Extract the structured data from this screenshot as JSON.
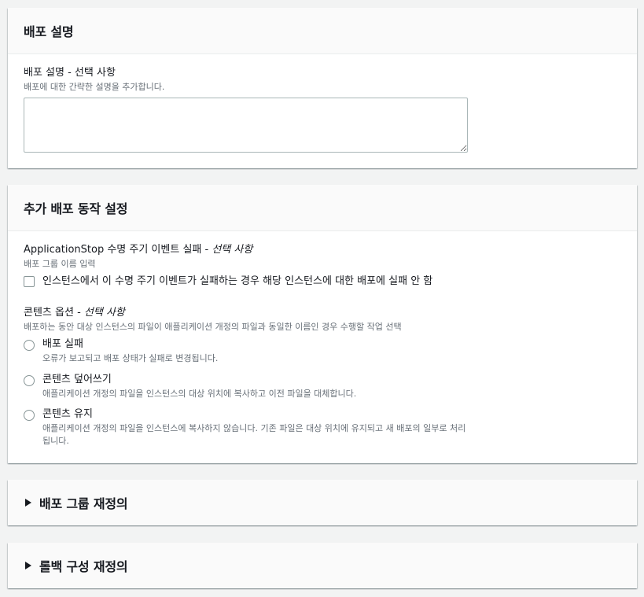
{
  "deployment_description": {
    "panel_title": "배포 설명",
    "field_label": "배포 설명 - 선택 사항",
    "field_desc": "배포에 대한 간략한 설명을 추가합니다.",
    "textarea_value": ""
  },
  "additional_settings": {
    "panel_title": "추가 배포 동작 설정",
    "app_stop": {
      "label_main": "ApplicationStop 수명 주기 이벤트 실패 - ",
      "label_optional": "선택 사항",
      "desc": "배포 그룹 이름 입력",
      "checkbox_label": "인스턴스에서 이 수명 주기 이벤트가 실패하는 경우 해당 인스턴스에 대한 배포에 실패 안 함",
      "checked": false
    },
    "content_options": {
      "label_main": "콘텐츠 옵션 - ",
      "label_optional": "선택 사항",
      "desc": "배포하는 동안 대상 인스턴스의 파일이 애플리케이션 개정의 파일과 동일한 이름인 경우 수행할 작업 선택",
      "options": [
        {
          "label": "배포 실패",
          "desc": "오류가 보고되고 배포 상태가 실패로 변경됩니다."
        },
        {
          "label": "콘텐츠 덮어쓰기",
          "desc": "애플리케이션 개정의 파일을 인스턴스의 대상 위치에 복사하고 이전 파일을 대체합니다."
        },
        {
          "label": "콘텐츠 유지",
          "desc": "애플리케이션 개정의 파일을 인스턴스에 복사하지 않습니다. 기존 파일은 대상 위치에 유지되고 새 배포의 일부로 처리됩니다."
        }
      ]
    }
  },
  "expandables": [
    {
      "title": "배포 그룹 재정의"
    },
    {
      "title": "롤백 구성 재정의"
    }
  ]
}
